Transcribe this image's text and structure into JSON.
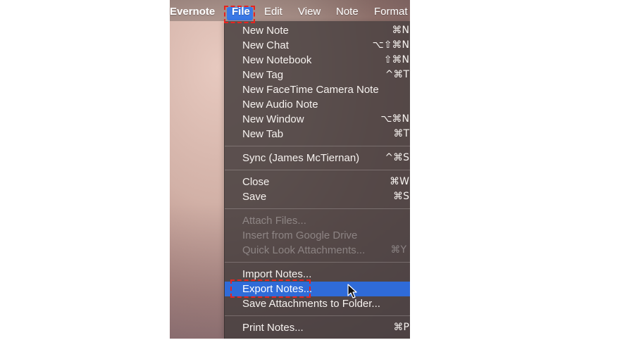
{
  "menubar": {
    "app_name": "Evernote",
    "items": [
      "File",
      "Edit",
      "View",
      "Note",
      "Format"
    ],
    "active_item": "File",
    "active_color": "#3a78e6"
  },
  "file_menu": {
    "items": [
      {
        "label": "New Note",
        "shortcut": "⌘N",
        "enabled": true
      },
      {
        "label": "New Chat",
        "shortcut": "⌥⇧⌘N",
        "enabled": true
      },
      {
        "label": "New Notebook",
        "shortcut": "⇧⌘N",
        "enabled": true
      },
      {
        "label": "New Tag",
        "shortcut": "^⌘T",
        "enabled": true
      },
      {
        "label": "New FaceTime Camera Note",
        "shortcut": "",
        "enabled": true
      },
      {
        "label": "New Audio Note",
        "shortcut": "",
        "enabled": true
      },
      {
        "label": "New Window",
        "shortcut": "⌥⌘N",
        "enabled": true
      },
      {
        "label": "New Tab",
        "shortcut": "⌘T",
        "enabled": true
      },
      {
        "label": "Sync (James McTiernan)",
        "shortcut": "^⌘S",
        "enabled": true
      },
      {
        "label": "Close",
        "shortcut": "⌘W",
        "enabled": true
      },
      {
        "label": "Save",
        "shortcut": "⌘S",
        "enabled": true
      },
      {
        "label": "Attach Files...",
        "shortcut": "",
        "enabled": false
      },
      {
        "label": "Insert from Google Drive",
        "shortcut": "",
        "enabled": false
      },
      {
        "label": "Quick Look Attachments...",
        "shortcut": "⌘Y",
        "enabled": false
      },
      {
        "label": "Import Notes...",
        "shortcut": "",
        "enabled": true
      },
      {
        "label": "Export Notes...",
        "shortcut": "",
        "enabled": true,
        "highlighted": true
      },
      {
        "label": "Save Attachments to Folder...",
        "shortcut": "",
        "enabled": true
      },
      {
        "label": "Print Notes...",
        "shortcut": "⌘P",
        "enabled": true
      }
    ],
    "highlight_color": "#2f6bd8"
  },
  "annotation_color": "#e8231f"
}
